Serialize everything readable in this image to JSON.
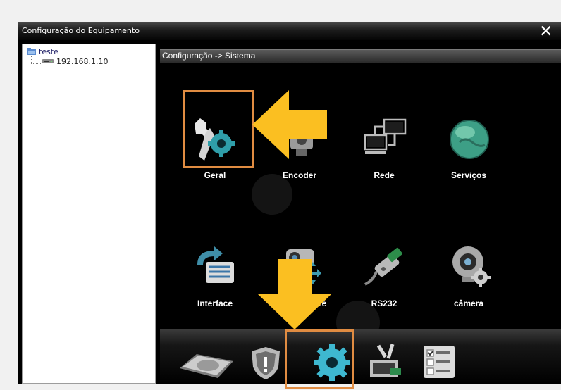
{
  "window": {
    "title": "Configuração do Equipamento",
    "close_icon": "✕"
  },
  "tree": {
    "root": "teste",
    "child": "192.168.1.10"
  },
  "panel": {
    "breadcrumb": "Configuração -> Sistema"
  },
  "grid": [
    {
      "label": "Geral",
      "icon": "wrench-gear-icon"
    },
    {
      "label": "Encoder",
      "icon": "encoder-icon"
    },
    {
      "label": "Rede",
      "icon": "network-icon"
    },
    {
      "label": "Serviços",
      "icon": "globe-icon"
    },
    {
      "label": "Interface",
      "icon": "interface-icon"
    },
    {
      "label": "o…  ito de pre",
      "icon": "ptz-camera-icon"
    },
    {
      "label": "RS232",
      "icon": "rs232-cable-icon"
    },
    {
      "label": "câmera",
      "icon": "camera-icon"
    }
  ],
  "bottom_bar": [
    "disk-icon",
    "shield-icon",
    "gear-icon",
    "maintenance-icon",
    "checklist-icon"
  ],
  "colors": {
    "highlight": "#e08c42",
    "arrow": "#fbbf21"
  }
}
